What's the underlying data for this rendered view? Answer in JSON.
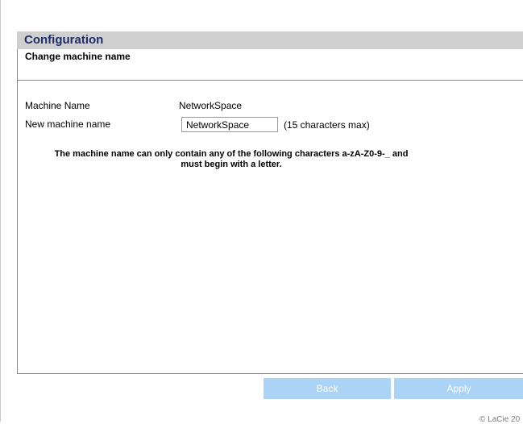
{
  "header": {
    "title": "Configuration"
  },
  "section": {
    "title": "Change machine name"
  },
  "fields": {
    "machine_name_label": "Machine Name",
    "machine_name_value": "NetworkSpace",
    "new_name_label": "New machine name",
    "new_name_value": "NetworkSpace",
    "new_name_hint": "(15 characters max)"
  },
  "notice": {
    "line1": "The machine name can only contain any of the following characters a-zA-Z0-9-_ and",
    "line2": "must begin with a letter."
  },
  "buttons": {
    "back": "Back",
    "apply": "Apply"
  },
  "footer": {
    "copyright": "© LaCie 20"
  },
  "colors": {
    "header_bg": "#cfcfcf",
    "header_text": "#1d2f6b",
    "button_bg": "#aad3f6"
  }
}
